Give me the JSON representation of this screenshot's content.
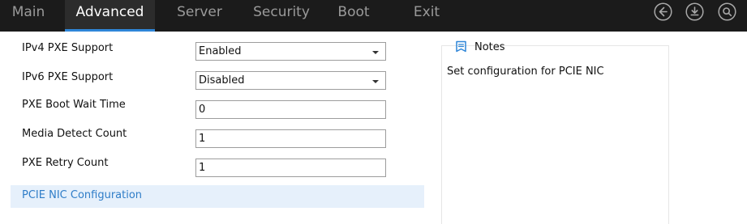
{
  "tabs": [
    {
      "label": "Main",
      "active": false
    },
    {
      "label": "Advanced",
      "active": true
    },
    {
      "label": "Server",
      "active": false
    },
    {
      "label": "Security",
      "active": false
    },
    {
      "label": "Boot",
      "active": false
    },
    {
      "label": "Exit",
      "active": false
    }
  ],
  "nav_icons": [
    "back-icon",
    "save-icon",
    "search-icon"
  ],
  "settings": [
    {
      "label": "IPv4 PXE Support",
      "type": "select",
      "value": "Enabled"
    },
    {
      "label": "IPv6 PXE Support",
      "type": "select",
      "value": "Disabled"
    },
    {
      "label": "PXE Boot Wait Time",
      "type": "text",
      "value": "0"
    },
    {
      "label": "Media Detect Count",
      "type": "text",
      "value": "1"
    },
    {
      "label": "PXE Retry Count",
      "type": "text",
      "value": "1"
    }
  ],
  "submenu": {
    "label": "PCIE NIC Configuration"
  },
  "notes": {
    "title": "Notes",
    "text": "Set configuration for PCIE NIC"
  },
  "colors": {
    "topbar_bg": "#1b1b1b",
    "active_tab_bg": "#2c2c2c",
    "accent": "#2f86d8",
    "submenu_bg": "#e6f0fb",
    "submenu_text": "#2f7dc8"
  }
}
